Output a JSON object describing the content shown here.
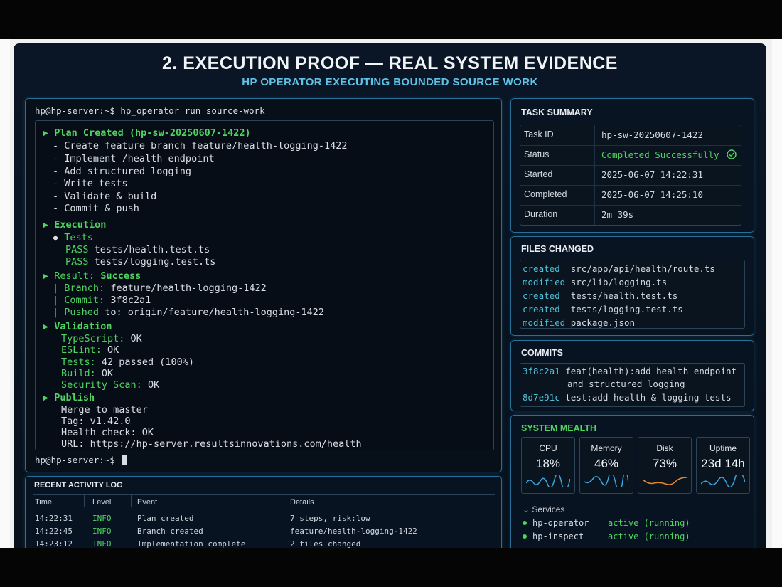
{
  "header": {
    "title": "2. EXECUTION PROOF — REAL SYSTEM EVIDENCE",
    "subtitle": "HP OPERATOR EXECUTING BOUNDED SOURCE WORK"
  },
  "terminal": {
    "command": "hp@hp-server:~$ hp_operator run source-work",
    "prompt": "hp@hp-server:~$",
    "plan": {
      "title": "Plan Created (hp-sw-20250607-1422)",
      "items": [
        "- Create feature branch feature/health-logging-1422",
        "- Implement /health endpoint",
        "- Add structured logging",
        "- Write tests",
        "- Validate & build",
        "- Commit & push"
      ]
    },
    "execution": {
      "title": "Execution",
      "sub": "Tests",
      "results": [
        {
          "status": "PASS",
          "file": "tests/health.test.ts"
        },
        {
          "status": "PASS",
          "file": "tests/logging.test.ts"
        }
      ]
    },
    "result": {
      "label": "Result:",
      "value": "Success",
      "branch_label": "Branch:",
      "branch": "feature/health-logging-1422",
      "commit_label": "Commit:",
      "commit": "3f8c2a1",
      "pushed_label": "Pushed",
      "pushed_to": "to:",
      "pushed": "origin/feature/health-logging-1422"
    },
    "validation": {
      "title": "Validation",
      "items": [
        {
          "label": "TypeScript:",
          "value": "OK"
        },
        {
          "label": "ESLint:",
          "value": "OK"
        },
        {
          "label": "Tests:",
          "value": "42 passed (100%)"
        },
        {
          "label": "Build:",
          "value": "OK"
        },
        {
          "label": "Security Scan:",
          "value": "OK"
        }
      ]
    },
    "publish": {
      "title": "Publish",
      "lines": [
        "Merge to master",
        "Tag: v1.42.0",
        "Health check: OK",
        "URL: https://hp-server.resultsinnovations.com/health"
      ]
    }
  },
  "task_summary": {
    "title": "TASK SUMMARY",
    "rows": [
      {
        "key": "Task ID",
        "value": "hp-sw-20250607-1422"
      },
      {
        "key": "Status",
        "value": "Completed Successfully"
      },
      {
        "key": "Started",
        "value": "2025-06-07 14:22:31"
      },
      {
        "key": "Completed",
        "value": "2025-06-07 14:25:10"
      },
      {
        "key": "Duration",
        "value": "2m 39s"
      }
    ],
    "status_color": "#4fd45f"
  },
  "files_changed": {
    "title": "FILES CHANGED",
    "rows": [
      {
        "action": "created",
        "path": "src/app/api/health/route.ts"
      },
      {
        "action": "modified",
        "path": "src/lib/logging.ts"
      },
      {
        "action": "created",
        "path": "tests/health.test.ts"
      },
      {
        "action": "created",
        "path": "tests/logging.test.ts"
      },
      {
        "action": "modified",
        "path": "package.json"
      }
    ]
  },
  "commits": {
    "title": "COMMITS",
    "rows": [
      {
        "hash": "3f8c2a1",
        "message": "feat(health):add health endpoint",
        "message2": "and structured logging"
      },
      {
        "hash": "8d7e91c",
        "message": "test:add health & logging tests"
      }
    ]
  },
  "system_health": {
    "title": "SYSTEM MEALTH",
    "tiles": [
      {
        "name": "CPU",
        "value": "18%",
        "color": "#3aa6e0"
      },
      {
        "name": "Memory",
        "value": "46%",
        "color": "#3aa6e0"
      },
      {
        "name": "Disk",
        "value": "73%",
        "color": "#e8872f"
      },
      {
        "name": "Uptime",
        "value": "23d 14h",
        "color": "#3aa6e0"
      }
    ],
    "services_label": "Services",
    "services": [
      {
        "name": "hp-operator",
        "status": "active (running)"
      },
      {
        "name": "hp-inspect",
        "status": "active (running)"
      }
    ]
  },
  "activity_log": {
    "title": "RECENT ACTIVITY LOG",
    "columns": [
      "Time",
      "Level",
      "Event",
      "Details"
    ],
    "rows": [
      {
        "time": "14:22:31",
        "level": "INFO",
        "event": "Plan created",
        "details": "7 steps, risk:low"
      },
      {
        "time": "14:22:45",
        "level": "INFO",
        "event": "Branch created",
        "details": "feature/health-logging-1422"
      },
      {
        "time": "14:23:12",
        "level": "INFO",
        "event": "Implementation complete",
        "details": "2 files changed"
      }
    ]
  }
}
